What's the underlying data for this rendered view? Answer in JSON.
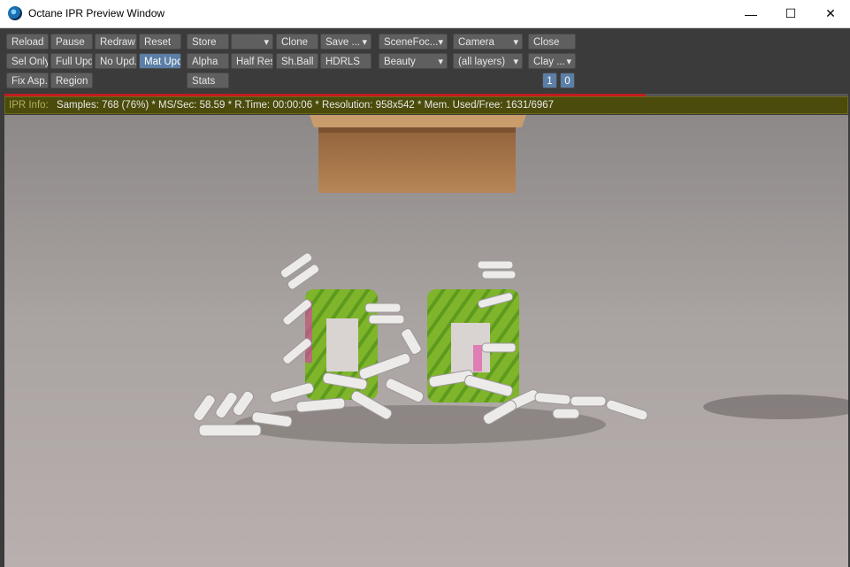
{
  "window": {
    "title": "Octane IPR Preview Window",
    "minimize": "—",
    "maximize": "☐",
    "close": "✕"
  },
  "toolbar": {
    "reload": "Reload",
    "pause": "Pause",
    "redraw": "Redraw",
    "reset": "Reset",
    "store": "Store",
    "store_dd": "",
    "clone": "Clone",
    "save": "Save ...",
    "scene_focus": "SceneFoc...",
    "camera": "Camera",
    "close": "Close",
    "sel_only": "Sel Only",
    "full_upd": "Full Upd.",
    "no_upd": "No Upd.",
    "mat_upd": "Mat Upd",
    "alpha": "Alpha",
    "half_res": "Half Res",
    "sh_ball": "Sh.Ball",
    "hdrls": "HDRLS",
    "beauty": "Beauty",
    "layers": "(all layers)",
    "clay": "Clay ...",
    "fix_asp": "Fix Asp.",
    "region": "Region",
    "stats": "Stats",
    "num1": "1",
    "num0": "0"
  },
  "progress": {
    "fraction": 0.76
  },
  "ipr_info": {
    "label": "IPR Info:",
    "text": "Samples: 768 (76%)  *  MS/Sec: 58.59  *  R.Time: 00:00:06  *  Resolution: 958x542  *  Mem. Used/Free: 1631/6967"
  }
}
